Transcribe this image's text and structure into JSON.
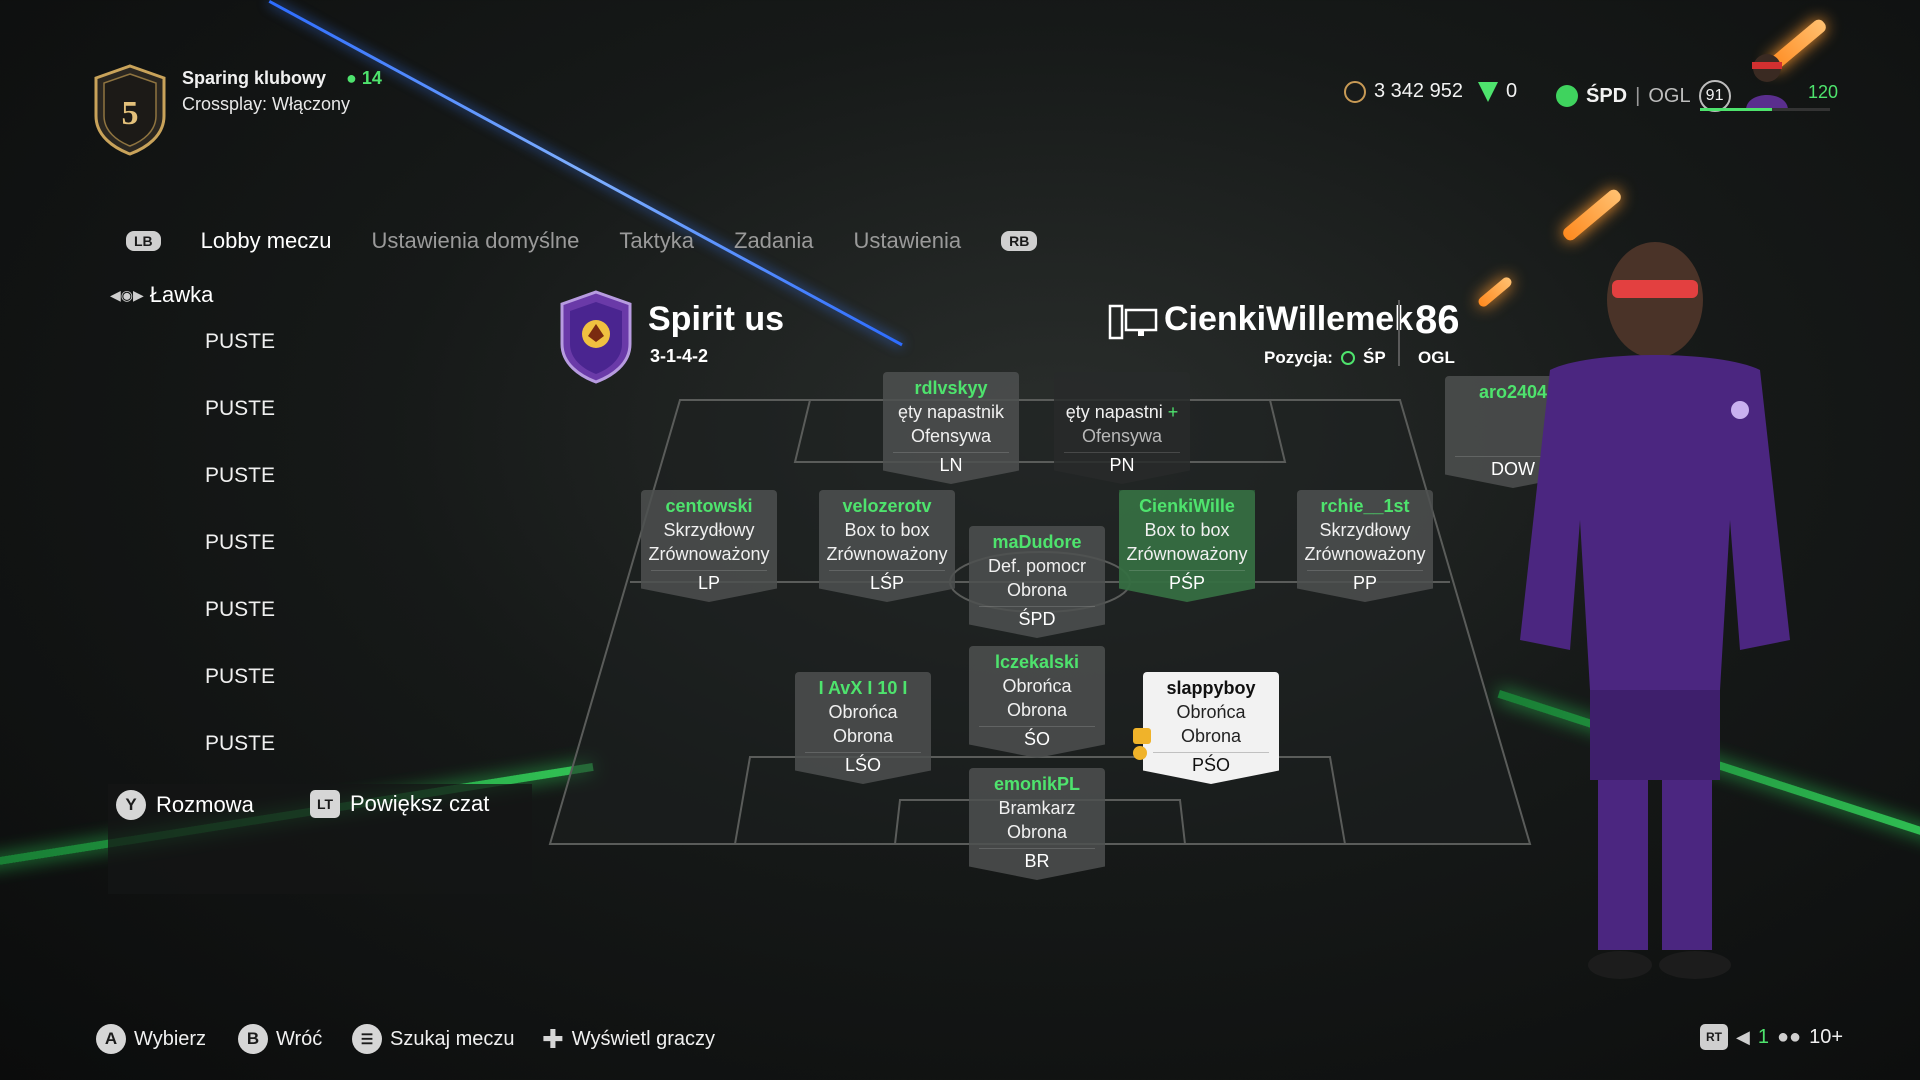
{
  "header": {
    "match_title": "Sparing klubowy",
    "members_count": "14",
    "crossplay": "Crossplay: Włączony",
    "level": "5"
  },
  "topbar": {
    "coins": "3 342 952",
    "points": "0",
    "position": "ŚPD",
    "ovr_label": "OGL",
    "ovr_value": "91",
    "xp": "120"
  },
  "tabs": {
    "left_bumper": "LB",
    "right_bumper": "RB",
    "items": [
      "Lobby meczu",
      "Ustawienia domyślne",
      "Taktyka",
      "Zadania",
      "Ustawienia"
    ]
  },
  "bench": {
    "title": "Ławka",
    "slots": [
      "PUSTE",
      "PUSTE",
      "PUSTE",
      "PUSTE",
      "PUSTE",
      "PUSTE",
      "PUSTE"
    ]
  },
  "chat": {
    "talk_button": "Y",
    "talk_label": "Rozmowa",
    "enlarge_button": "LT",
    "enlarge_label": "Powiększ czat"
  },
  "team": {
    "name": "Spirit us",
    "formation": "3-1-4-2",
    "player_name": "CienkiWillemek",
    "position_label": "Pozycja:",
    "position_value": "ŚP",
    "ovr_value": "86",
    "ovr_label": "OGL"
  },
  "cards": [
    {
      "id": "ln",
      "name": "rdlvskyy",
      "l1": "ęty napastnik",
      "l2": "Ofensywa",
      "pos": "LN"
    },
    {
      "id": "pn",
      "name": "",
      "l1": "ęty napastni",
      "l2": "Ofensywa",
      "pos": "PN"
    },
    {
      "id": "dow",
      "name": "aro2404",
      "l1": "",
      "l2": "",
      "pos": "DOW"
    },
    {
      "id": "lp",
      "name": "centowski",
      "l1": "Skrzydłowy",
      "l2": "Zrównoważony",
      "pos": "LP"
    },
    {
      "id": "lsp",
      "name": "velozerotv",
      "l1": "Box to box",
      "l2": "Zrównoważony",
      "pos": "LŚP"
    },
    {
      "id": "spd",
      "name": "maDudore",
      "l1": "Def. pomocr",
      "l2": "Obrona",
      "pos": "ŚPD"
    },
    {
      "id": "psp",
      "name": "CienkiWille",
      "l1": "Box to box",
      "l2": "Zrównoważony",
      "pos": "PŚP"
    },
    {
      "id": "pp",
      "name": "rchie__1st",
      "l1": "Skrzydłowy",
      "l2": "Zrównoważony",
      "pos": "PP"
    },
    {
      "id": "lso",
      "name": "I AvX I 10 I",
      "l1": "Obrońca",
      "l2": "Obrona",
      "pos": "LŚO"
    },
    {
      "id": "so",
      "name": "lczekalski",
      "l1": "Obrońca",
      "l2": "Obrona",
      "pos": "ŚO"
    },
    {
      "id": "pso",
      "name": "slappyboy",
      "l1": "Obrońca",
      "l2": "Obrona",
      "pos": "PŚO"
    },
    {
      "id": "br",
      "name": "emonikPL",
      "l1": "Bramkarz",
      "l2": "Obrona",
      "pos": "BR"
    }
  ],
  "bottom": {
    "a_btn": "A",
    "a_label": "Wybierz",
    "b_btn": "B",
    "b_label": "Wróć",
    "menu_label": "Szukaj meczu",
    "dpad_label": "Wyświetl graczy",
    "rt_btn": "RT",
    "mute_count": "1",
    "players_count": "10+"
  },
  "colors": {
    "accent_green": "#4ee36d",
    "selected_glow": "#35d35a",
    "team_crest": "#6a3aa8"
  }
}
